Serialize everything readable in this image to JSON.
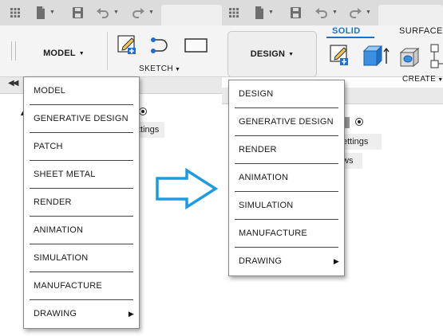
{
  "left_panel": {
    "workspace_button": "MODEL",
    "sketch_group_label": "SKETCH",
    "tab_partial_text": "ttings",
    "menu_items": [
      {
        "label": "MODEL",
        "has_submenu": false
      },
      {
        "label": "GENERATIVE DESIGN",
        "has_submenu": false
      },
      {
        "label": "PATCH",
        "has_submenu": false
      },
      {
        "label": "SHEET METAL",
        "has_submenu": false
      },
      {
        "label": "RENDER",
        "has_submenu": false
      },
      {
        "label": "ANIMATION",
        "has_submenu": false
      },
      {
        "label": "SIMULATION",
        "has_submenu": false
      },
      {
        "label": "MANUFACTURE",
        "has_submenu": false
      },
      {
        "label": "DRAWING",
        "has_submenu": true
      }
    ]
  },
  "right_panel": {
    "workspace_button": "DESIGN",
    "tab_solid": "SOLID",
    "tab_surface": "SURFACE",
    "create_group_label": "CREATE",
    "settings_partial_text": "ettings",
    "views_partial_text": "ws",
    "menu_items": [
      {
        "label": "DESIGN",
        "has_submenu": false
      },
      {
        "label": "GENERATIVE DESIGN",
        "has_submenu": false
      },
      {
        "label": "RENDER",
        "has_submenu": false
      },
      {
        "label": "ANIMATION",
        "has_submenu": false
      },
      {
        "label": "SIMULATION",
        "has_submenu": false
      },
      {
        "label": "MANUFACTURE",
        "has_submenu": false
      },
      {
        "label": "DRAWING",
        "has_submenu": true
      }
    ]
  },
  "arrow": {
    "color": "#1e9be0",
    "icon": "right-arrow-icon"
  },
  "colors": {
    "accent": "#1a73c8",
    "toolbar_bg": "#dcdcdc",
    "ribbon_bg": "#f4f4f4"
  }
}
